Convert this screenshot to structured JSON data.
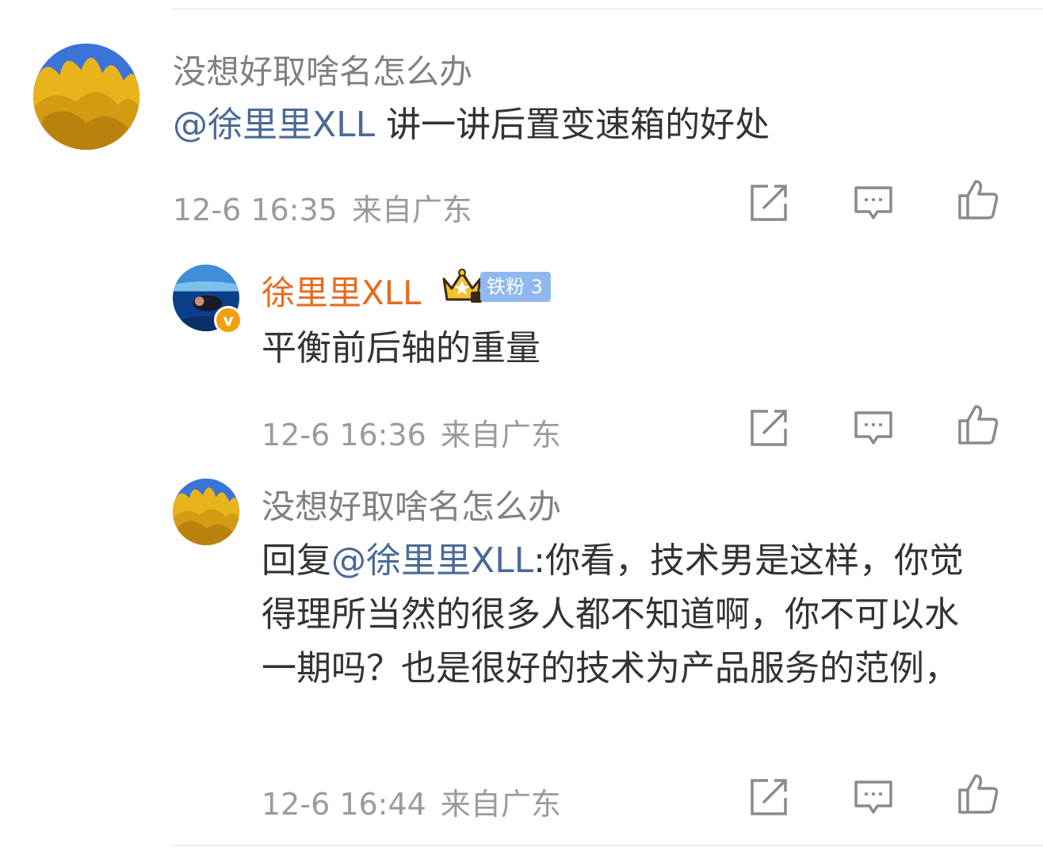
{
  "comments": [
    {
      "username": "没想好取啥名怎么办",
      "mention": "@徐里里XLL",
      "text": " 讲一讲后置变速箱的好处",
      "time": "12-6 16:35",
      "location": "来自广东"
    }
  ],
  "replies": [
    {
      "username": "徐里里XLL",
      "fan_badge": "铁粉 3",
      "verified_badge": "v",
      "text": "平衡前后轴的重量",
      "time": "12-6 16:36",
      "location": "来自广东"
    },
    {
      "username": "没想好取啥名怎么办",
      "reply_prefix": "回复",
      "mention": "@徐里里XLL",
      "text": ":你看，技术男是这样，你觉得理所当然的很多人都不知道啊，你不可以水一期吗？也是很好的技术为产品服务的范例，",
      "time": "12-6 16:44",
      "location": "来自广东"
    }
  ],
  "icons": {
    "share": "share-icon",
    "comment": "comment-icon",
    "like": "like-icon"
  },
  "colors": {
    "author_name": "#e86a1e",
    "mention": "#4a6a98",
    "meta": "#9b9b9b",
    "fan_badge": "#8fb8ec"
  }
}
